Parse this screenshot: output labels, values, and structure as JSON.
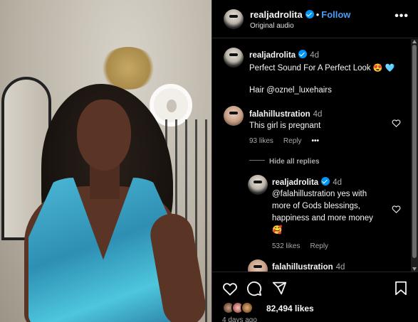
{
  "post": {
    "username": "realjadrolita",
    "follow_label": "Follow",
    "dot": "•",
    "subtitle": "Original audio",
    "more": "•••"
  },
  "caption": {
    "username": "realjadrolita",
    "time": "4d",
    "line1": "Perfect Sound For A Perfect Look",
    "line1_emojis": "😍 🩵",
    "line2": "Hair @oznel_luxehairs"
  },
  "comments": [
    {
      "username": "falahillustration",
      "time": "4d",
      "text": "This girl is pregnant",
      "likes": "93 likes",
      "reply": "Reply",
      "more": "•••",
      "hide_replies": "Hide all replies"
    }
  ],
  "reply": {
    "username": "realjadrolita",
    "time": "4d",
    "line1": "@falahillustration yes with",
    "line2": "more of Gods blessings,",
    "line3": "happiness and more money",
    "emoji": "🥰",
    "likes": "532 likes",
    "reply": "Reply"
  },
  "next_comment": {
    "username": "falahillustration",
    "time": "4d"
  },
  "footer": {
    "likes": "82,494 likes",
    "date": "4 days ago"
  },
  "colors": {
    "accent": "#4a9ef5",
    "verified": "#0095f6",
    "background": "#000000",
    "muted": "#a8a8a8"
  },
  "icons": [
    "heart-icon",
    "comment-icon",
    "share-icon",
    "bookmark-icon",
    "more-icon",
    "verified-icon"
  ]
}
